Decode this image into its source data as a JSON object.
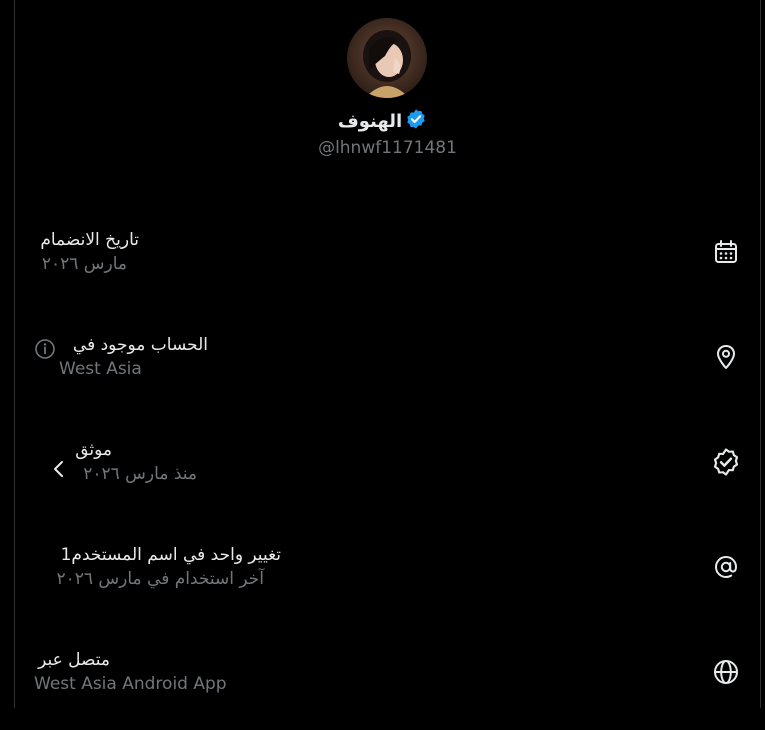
{
  "profile": {
    "display_name": "الهنوف",
    "handle": "@lhnwf1171481",
    "verified_badge_icon": "verified-badge-icon",
    "verified_color": "#1d9bf0"
  },
  "rows": {
    "joined": {
      "title": "تاريخ الانضمام",
      "subtitle": "مارس ٢٠٢٦",
      "icon": "calendar-icon"
    },
    "location": {
      "title": "الحساب موجود في",
      "subtitle": "West Asia",
      "icon": "location-pin-icon",
      "info_icon": "info-icon"
    },
    "verified": {
      "title": "موثق",
      "subtitle": "منذ مارس ٢٠٢٦",
      "icon": "verified-check-icon",
      "chevron_icon": "chevron-left-icon"
    },
    "username_change": {
      "title": "تغيير واحد في اسم المستخدم1",
      "subtitle": "آخر استخدام في مارس ٢٠٢٦",
      "icon": "at-sign-icon"
    },
    "connected_via": {
      "title": "متصل عبر",
      "subtitle": "West Asia Android App",
      "icon": "globe-icon"
    }
  },
  "colors": {
    "background": "#000000",
    "primary_text": "#e7e9ea",
    "secondary_text": "#71767b",
    "border": "#2f3336"
  }
}
